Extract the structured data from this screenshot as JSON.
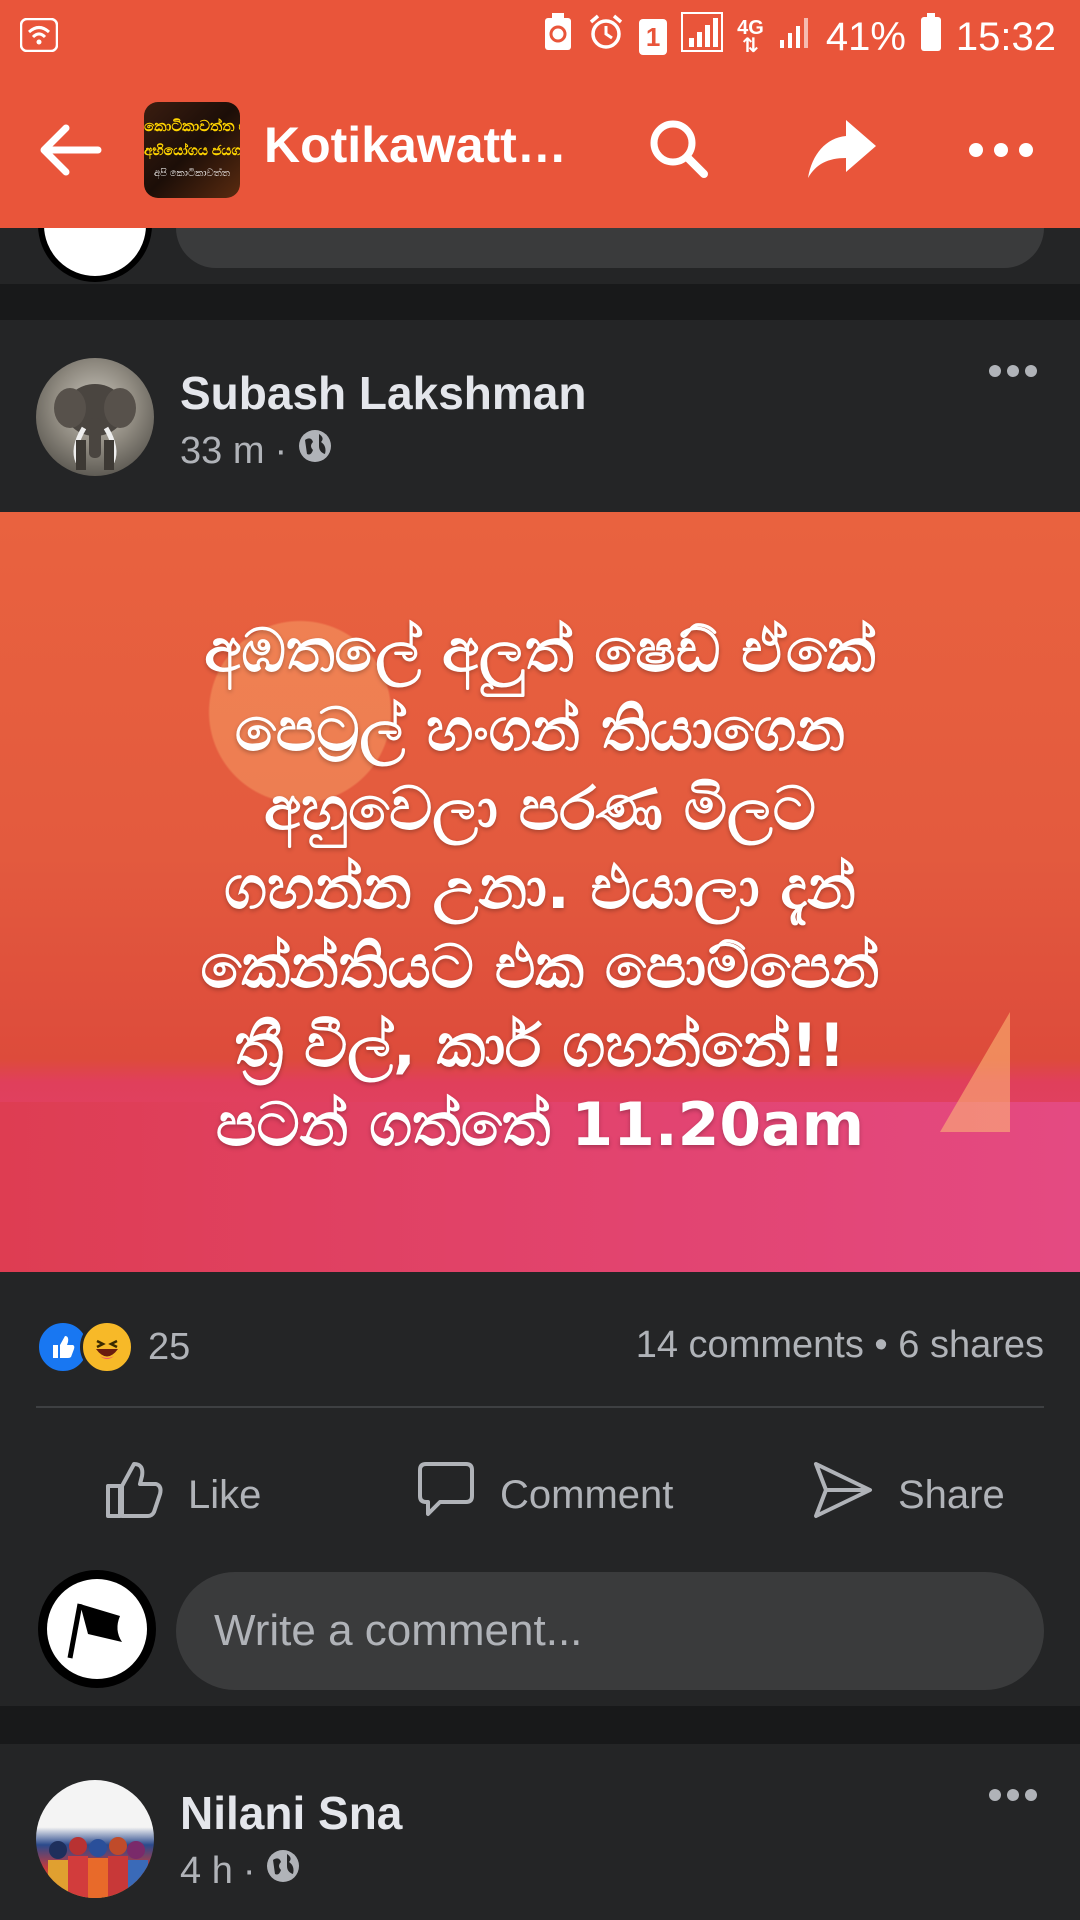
{
  "status_bar": {
    "battery": "41%",
    "time": "15:32",
    "network": "4G",
    "sim_badge": "1"
  },
  "app_bar": {
    "page_title": "Kotikawatta...",
    "page_avatar_lines": [
      "කොටිකාවත්ත එකමුතු",
      "අභියෝගය ජයගමු",
      "අපි කොටිකාවත්ත"
    ],
    "icons": [
      "back-arrow-icon",
      "search-icon",
      "share-arrow-icon",
      "more-dots-icon"
    ]
  },
  "post": {
    "author": "Subash Lakshman",
    "time": "33 m",
    "separator": "·",
    "audience_icon": "globe-icon",
    "image_text_lines": [
      "අඹතලේ අලුත් ෂෙඩ් ඒකේ",
      "පෙට්‍රල් හංගන් තියාගෙන",
      "අහුවෙලා පරණ මිලට",
      "ගහන්න උනා. එයාලා දැන්",
      "කේන්තියට  එක පොම්පෙන්",
      "ත්‍රී වීල්, කාර් ගහන්නේ!!",
      "පටන් ගත්තේ 11.20am"
    ],
    "reactions": {
      "types": [
        "like",
        "haha"
      ],
      "count": "25"
    },
    "stats": "14 comments • 6 shares",
    "actions": {
      "like": "Like",
      "comment": "Comment",
      "share": "Share"
    },
    "comment_placeholder": "Write a comment..."
  },
  "next_post": {
    "author": "Nilani Sna",
    "time": "4 h",
    "separator": "·",
    "audience_icon": "globe-icon"
  },
  "colors": {
    "app_bar": "#e9553a",
    "card": "#242526",
    "background": "#18191a",
    "like_blue": "#1877f2",
    "haha_yellow": "#f7b928"
  }
}
